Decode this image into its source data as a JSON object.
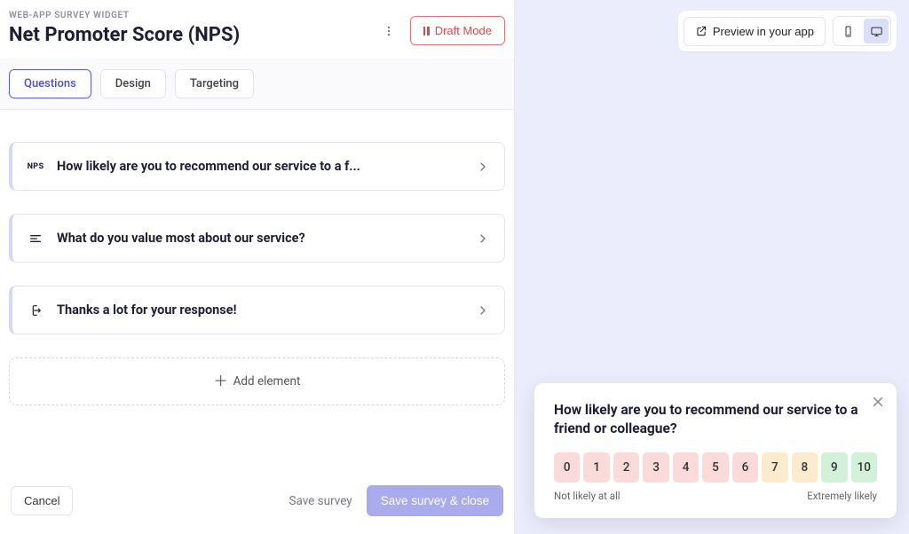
{
  "eyebrow": "WEB-APP SURVEY WIDGET",
  "title": "Net Promoter Score (NPS)",
  "draft_button": "Draft Mode",
  "tabs": {
    "questions": "Questions",
    "design": "Design",
    "targeting": "Targeting"
  },
  "cards": {
    "nps_badge": "NPS",
    "q1": "How likely are you to recommend our service to a f...",
    "q2": "What do you value most about our service?",
    "q3": "Thanks a lot for your response!"
  },
  "add_element": "Add element",
  "footer": {
    "cancel": "Cancel",
    "save": "Save survey",
    "save_close": "Save survey & close"
  },
  "preview": {
    "button": "Preview in your app"
  },
  "widget": {
    "question": "How likely are you to recommend our service to a friend or colleague?",
    "scale": {
      "b0": "0",
      "b1": "1",
      "b2": "2",
      "b3": "3",
      "b4": "4",
      "b5": "5",
      "b6": "6",
      "b7": "7",
      "b8": "8",
      "b9": "9",
      "b10": "10",
      "colors": {
        "detractor": "#fbdada",
        "passive": "#fceccd",
        "promoter": "#d3f0d8"
      }
    },
    "low_label": "Not likely at all",
    "high_label": "Extremely likely"
  }
}
